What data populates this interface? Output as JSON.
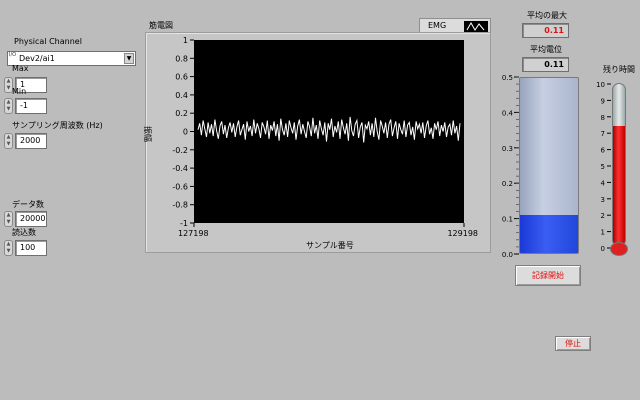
{
  "controls": {
    "physical_channel": {
      "label": "Physical Channel",
      "value": "Dev2/ai1",
      "tag": "I/O"
    },
    "max": {
      "label": "Max",
      "value": "1"
    },
    "min": {
      "label": "Min",
      "value": "-1"
    },
    "sample_rate": {
      "label": "サンプリング周波数 (Hz)",
      "value": "2000"
    },
    "data_count": {
      "label": "データ数",
      "value": "20000"
    },
    "read_count": {
      "label": "読込数",
      "value": "100"
    }
  },
  "chart": {
    "title": "筋電図",
    "legend_name": "EMG",
    "xlabel": "サンプル番号",
    "ylabel": "振幅"
  },
  "chart_data": {
    "type": "line",
    "title": "筋電図",
    "xlabel": "サンプル番号",
    "ylabel": "振幅",
    "xlim": [
      127198,
      129198
    ],
    "ylim": [
      -1,
      1
    ],
    "x_ticks": [
      "127198",
      "129198"
    ],
    "y_ticks": [
      "1",
      "0.8",
      "0.6",
      "0.4",
      "0.2",
      "0",
      "-0.2",
      "-0.4",
      "-0.6",
      "-0.8",
      "-1"
    ],
    "grid": false,
    "colors": {
      "line": "#ffffff",
      "background": "#000000"
    },
    "series": [
      {
        "name": "EMG",
        "values": [
          0.02,
          0.09,
          -0.04,
          0.12,
          0.03,
          -0.06,
          0.1,
          -0.02,
          0.08,
          -0.05,
          0.13,
          0.01,
          -0.08,
          0.06,
          0.11,
          -0.03,
          0.07,
          -0.07,
          0.04,
          0.1,
          -0.01,
          0.09,
          -0.06,
          0.05,
          0.12,
          -0.04,
          0.02,
          0.08,
          -0.09,
          0.11,
          0.0,
          0.06,
          -0.05,
          0.13,
          -0.02,
          0.09,
          0.03,
          -0.07,
          0.1,
          0.05,
          -0.03,
          0.12,
          -0.08,
          0.07,
          0.01,
          0.11,
          -0.05,
          0.08,
          -0.1,
          0.14,
          0.02,
          -0.04,
          0.09,
          -0.06,
          0.12,
          0.04,
          -0.02,
          0.1,
          -0.09,
          0.06,
          0.13,
          -0.03,
          0.08,
          0.0,
          -0.07,
          0.11,
          0.05,
          -0.05,
          0.15,
          -0.02,
          0.07,
          -0.08,
          0.12,
          0.03,
          -0.04,
          0.1,
          -0.11,
          0.09,
          0.02,
          0.14,
          -0.06,
          0.06,
          -0.01,
          0.11,
          -0.08,
          0.13,
          0.04,
          -0.03,
          0.09,
          -0.1,
          0.16,
          0.01,
          -0.05,
          0.08,
          0.12,
          -0.07,
          0.05,
          0.1,
          -0.12,
          0.07,
          0.03,
          0.11,
          -0.04,
          0.09,
          -0.06,
          0.15,
          0.0,
          -0.09,
          0.12,
          0.06,
          -0.02,
          0.1,
          -0.07,
          0.08,
          0.13,
          -0.05,
          0.04,
          0.11,
          -0.08,
          0.09,
          0.02,
          -0.03,
          0.12,
          -0.06,
          0.07,
          0.1,
          -0.04,
          0.05,
          -0.09,
          0.11,
          0.03,
          0.08,
          -0.02,
          0.1,
          -0.07,
          0.06,
          0.12,
          -0.03,
          0.04,
          -0.08,
          0.09,
          0.02,
          0.11,
          -0.05,
          0.07,
          0.0,
          0.1,
          -0.06,
          0.05,
          0.08,
          -0.04,
          0.12,
          -0.02,
          0.06,
          -0.1,
          0.09
        ]
      }
    ]
  },
  "indicators": {
    "avg_max": {
      "label": "平均の最大",
      "value": "0.11",
      "color": "#e01010"
    },
    "avg_potential": {
      "label": "平均電位",
      "value": "0.11"
    }
  },
  "tank": {
    "level": 0.11,
    "scale": {
      "min": 0,
      "max": 0.5
    },
    "ticks": [
      "0.5",
      "0.4",
      "0.3",
      "0.2",
      "0.1",
      "0.0"
    ]
  },
  "thermometer": {
    "label": "残り時間",
    "value": 7.4,
    "scale": {
      "min": 0,
      "max": 10
    },
    "ticks": [
      "10",
      "9",
      "8",
      "7",
      "6",
      "5",
      "4",
      "3",
      "2",
      "1",
      "0"
    ]
  },
  "buttons": {
    "record_start": "記録開始",
    "stop": "停止"
  }
}
